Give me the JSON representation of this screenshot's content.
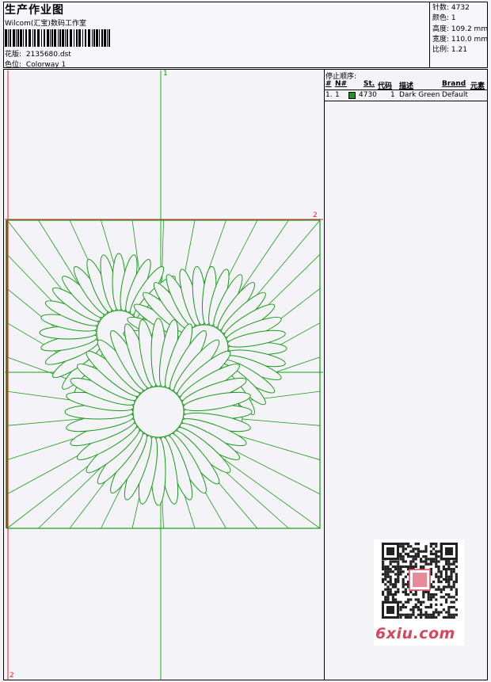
{
  "header": {
    "title": "生产作业图",
    "studio": "Wilcom(汇宝)数码工作室",
    "design_label": "花版:",
    "design_value": "2135680.dst",
    "colorway_label": "色位:",
    "colorway_value": "Colorway 1"
  },
  "stats": {
    "stitches_label": "针数:",
    "stitches_value": "4732",
    "colors_label": "颜色:",
    "colors_value": "1",
    "height_label": "高度:",
    "height_value": "109.2 mm",
    "width_label": "宽度:",
    "width_value": "110.0 mm",
    "scale_label": "比例:",
    "scale_value": "1.21"
  },
  "stop_sequence": {
    "title": "停止顺序:",
    "columns": [
      "#",
      "N#",
      "St.",
      "代码",
      "描述",
      "Brand",
      "元素"
    ],
    "rows": [
      {
        "num": "1.",
        "n": "1",
        "stitches": "4730",
        "code": "1",
        "desc": "Dark Green",
        "brand": "Default",
        "color": "#1a9a1a"
      }
    ]
  },
  "axes": {
    "v_top": "1",
    "h_right": "2",
    "bottom_left": "2"
  },
  "watermark": "6xiu.com",
  "colors": {
    "thread": "#1a9a1a",
    "guide_green": "#00c000",
    "guide_red": "#e02020",
    "hoop": "#7a4a00"
  }
}
